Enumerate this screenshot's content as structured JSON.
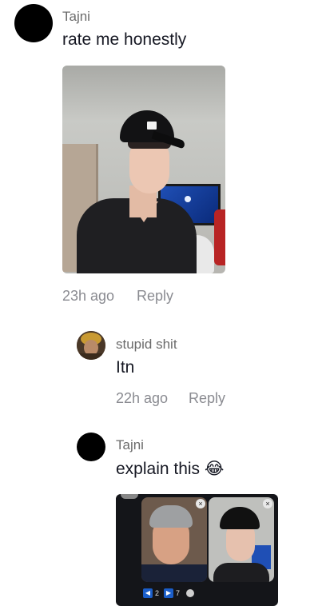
{
  "comments": [
    {
      "username": "Tajni",
      "text": "rate me honestly",
      "time": "23h ago",
      "reply_label": "Reply",
      "avatar_color": "#000000"
    },
    {
      "username": "stupid shit",
      "text": "Itn",
      "time": "22h ago",
      "reply_label": "Reply"
    },
    {
      "username": "Tajni",
      "text": "explain this 😂",
      "avatar_color": "#000000"
    }
  ],
  "embedded_screenshot": {
    "left_count": "2",
    "right_count": "7"
  },
  "colors": {
    "username": "#6b6b6b",
    "text": "#161823",
    "meta": "#8a8b91",
    "accent_blue": "#1b5ec9"
  }
}
